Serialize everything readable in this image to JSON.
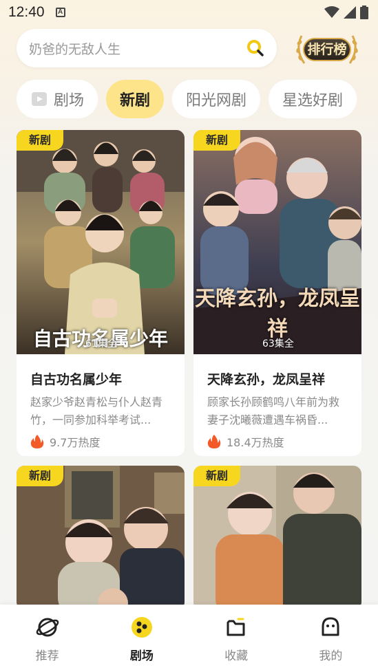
{
  "status_bar": {
    "time": "12:40",
    "notification_icon": "A"
  },
  "search": {
    "placeholder": "奶爸的无敌人生",
    "rank_label": "排行榜"
  },
  "tabs": [
    {
      "label": "剧场",
      "active": false
    },
    {
      "label": "新剧",
      "active": true
    },
    {
      "label": "阳光网剧",
      "active": false
    },
    {
      "label": "星选好剧",
      "active": false
    }
  ],
  "cards": [
    {
      "tag": "新剧",
      "episodes": "61集全",
      "poster_title": "自古功名属少年",
      "title": "自古功名属少年",
      "description": "赵家少爷赵青松与仆人赵青竹，一同参加科举考试...",
      "heat": "9.7万热度"
    },
    {
      "tag": "新剧",
      "episodes": "63集全",
      "poster_title": "天降玄孙，龙凤呈祥",
      "title": "天降玄孙，龙凤呈祥",
      "description": "顾家长孙顾鹤鸣八年前为救妻子沈曦薇遭遇车祸昏...",
      "heat": "18.4万热度"
    },
    {
      "tag": "新剧"
    },
    {
      "tag": "新剧"
    }
  ],
  "bottom_nav": [
    {
      "label": "推荐",
      "icon": "planet-icon"
    },
    {
      "label": "剧场",
      "icon": "theater-icon",
      "active": true
    },
    {
      "label": "收藏",
      "icon": "folder-icon"
    },
    {
      "label": "我的",
      "icon": "profile-icon"
    }
  ],
  "colors": {
    "accent": "#f7d61f",
    "active_tab": "#fde38a",
    "heat": "#f25a2a"
  }
}
